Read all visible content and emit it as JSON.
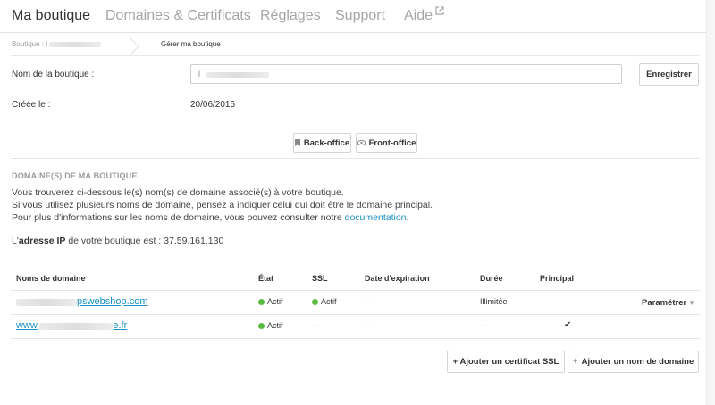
{
  "nav": {
    "tabs": [
      {
        "label": "Ma boutique",
        "active": true
      },
      {
        "label": "Domaines & Certificats"
      },
      {
        "label": "Réglages"
      },
      {
        "label": "Support"
      },
      {
        "label": "Aide"
      }
    ]
  },
  "breadcrumb": {
    "parent_label": "Boutique : l",
    "current_label": "Gérer ma boutique"
  },
  "store": {
    "name_label": "Nom de la boutique :",
    "name_value": "l",
    "save_label": "Enregistrer",
    "created_label": "Créée le :",
    "created_value": "20/06/2015",
    "backoffice_label": "Back-office",
    "frontoffice_label": "Front-office"
  },
  "domains": {
    "section_title": "DOMAINE(S) DE MA BOUTIQUE",
    "intro_line1": "Vous trouverez ci-dessous le(s) nom(s) de domaine associé(s) à votre boutique.",
    "intro_line2": "Si vous utilisez plusieurs noms de domaine, pensez à indiquer celui qui doit être le domaine principal.",
    "intro_line3_prefix": "Pour plus d'informations sur les noms de domaine, vous pouvez consulter notre ",
    "intro_line3_link": "documentation",
    "intro_line3_suffix": ".",
    "ip_prefix": "L'",
    "ip_bold": "adresse IP",
    "ip_suffix": " de votre boutique est : 37.59.161.130",
    "columns": [
      "Noms de domaine",
      "État",
      "SSL",
      "Date d'expiration",
      "Durée",
      "Principal"
    ],
    "rows": [
      {
        "domain_suffix": "pswebshop.com",
        "state": "Actif",
        "ssl": "Actif",
        "expiration": "--",
        "duration": "Illimitée",
        "principal": "",
        "action": "Paramétrer"
      },
      {
        "domain_prefix": "www",
        "domain_suffix": "e.fr",
        "state": "Actif",
        "ssl": "--",
        "expiration": "--",
        "duration": "--",
        "principal": "✔",
        "action": ""
      }
    ],
    "add_ssl_label": "+ Ajouter un certificat SSL",
    "add_domain_label": "Ajouter un nom de domaine",
    "add_domain_icon": "+"
  },
  "colors": {
    "accent_link": "#1a8fc4",
    "active_dot": "#5cbb42"
  }
}
